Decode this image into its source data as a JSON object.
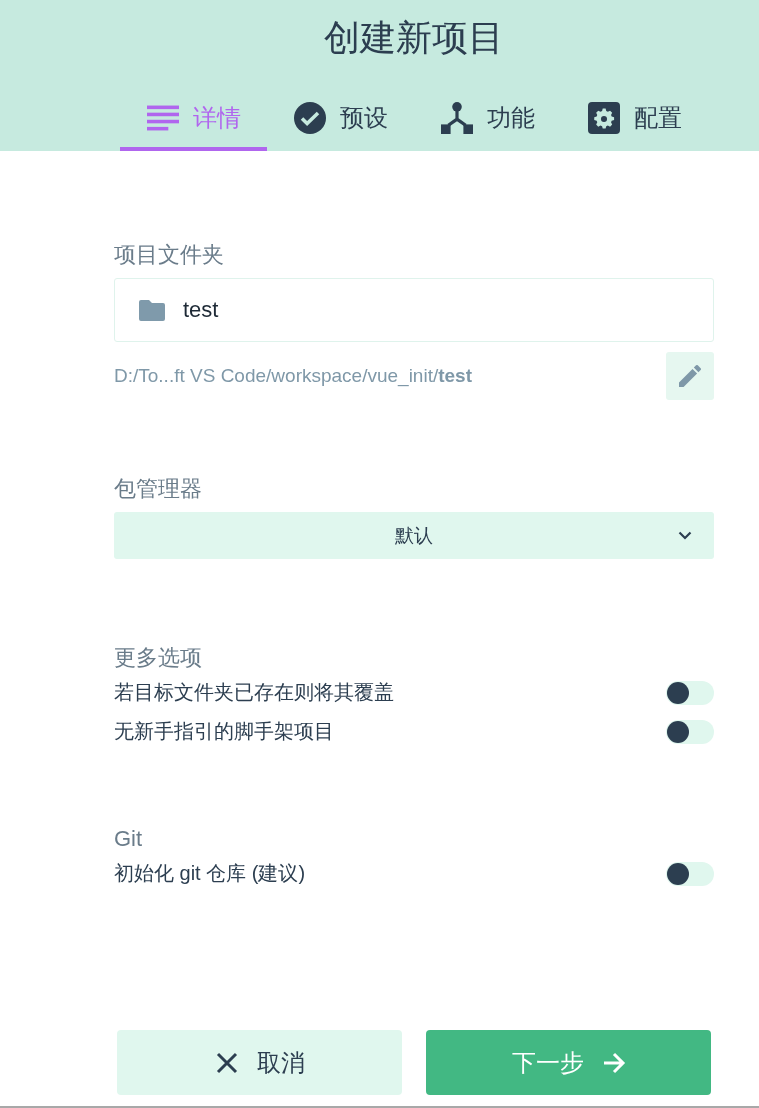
{
  "header": {
    "title": "创建新项目"
  },
  "tabs": [
    {
      "label": "详情",
      "selected": true
    },
    {
      "label": "预设",
      "selected": false
    },
    {
      "label": "功能",
      "selected": false
    },
    {
      "label": "配置",
      "selected": false
    }
  ],
  "folder": {
    "label": "项目文件夹",
    "value": "test",
    "path": "D:/To...ft VS Code/workspace/vue_init/**test**"
  },
  "package_manager": {
    "label": "包管理器",
    "value": "默认"
  },
  "more_options": {
    "label": "更多选项",
    "options": [
      {
        "label": "若目标文件夹已存在则将其覆盖",
        "on": false
      },
      {
        "label": "无新手指引的脚手架项目",
        "on": false
      }
    ]
  },
  "git": {
    "label": "Git",
    "options": [
      {
        "label": "初始化 git 仓库 (建议)",
        "on": false
      }
    ]
  },
  "buttons": [
    {
      "label": "取消",
      "kind": "cancel"
    },
    {
      "label": "下一步",
      "kind": "next"
    }
  ]
}
